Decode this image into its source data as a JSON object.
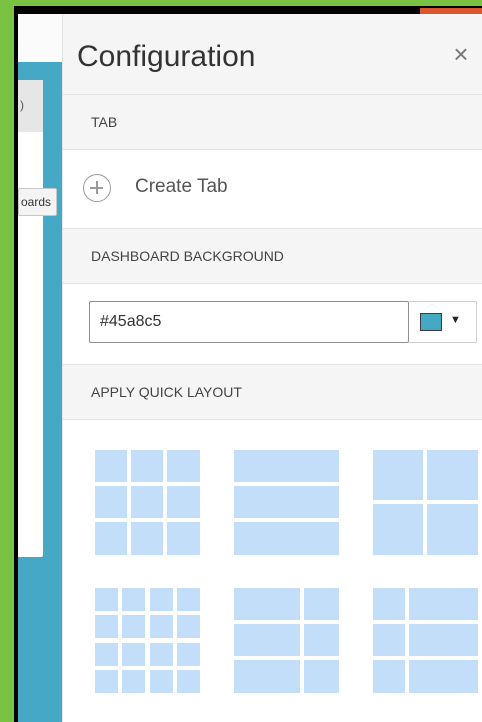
{
  "panel": {
    "title": "Configuration",
    "close_icon": "close-icon"
  },
  "background_dashboard": {
    "tooltip_text": "oards",
    "card_header_char": ")"
  },
  "sections": {
    "tab": {
      "heading": "TAB",
      "create_label": "Create Tab",
      "create_icon": "plus-circle-icon"
    },
    "background": {
      "heading": "DASHBOARD BACKGROUND",
      "value": "#45a8c5",
      "swatch_color": "#45a8c5",
      "dropdown_icon": "caret-down-icon"
    },
    "quick_layout": {
      "heading": "APPLY QUICK LAYOUT",
      "layouts": [
        "grid-3x3",
        "three-rows",
        "two-by-two",
        "grid-4x4",
        "wide-left-grid",
        "wide-right-grid"
      ]
    }
  },
  "colors": {
    "accent_green": "#7ac242",
    "accent_orange": "#d9572a",
    "layout_cell": "#c2def9",
    "dashboard_bg": "#45a8c5"
  }
}
